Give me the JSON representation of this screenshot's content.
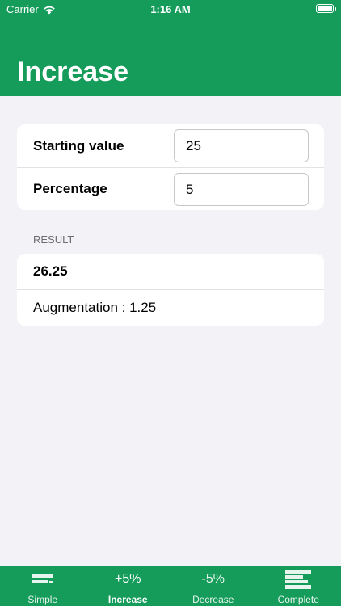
{
  "status_bar": {
    "carrier": "Carrier",
    "time": "1:16 AM"
  },
  "header": {
    "title": "Increase"
  },
  "inputs": [
    {
      "label": "Starting value",
      "value": "25"
    },
    {
      "label": "Percentage",
      "value": "5"
    }
  ],
  "result": {
    "section_title": "RESULT",
    "value": "26.25",
    "augmentation": "Augmentation : 1.25"
  },
  "tabs": [
    {
      "label": "Simple",
      "icon": "simple-bars-icon",
      "active": false
    },
    {
      "label": "Increase",
      "glyph": "+5%",
      "active": true
    },
    {
      "label": "Decrease",
      "glyph": "-5%",
      "active": false
    },
    {
      "label": "Complete",
      "icon": "complete-bars-icon",
      "active": false
    }
  ],
  "colors": {
    "accent": "#159c5b",
    "background": "#f2f2f7"
  }
}
